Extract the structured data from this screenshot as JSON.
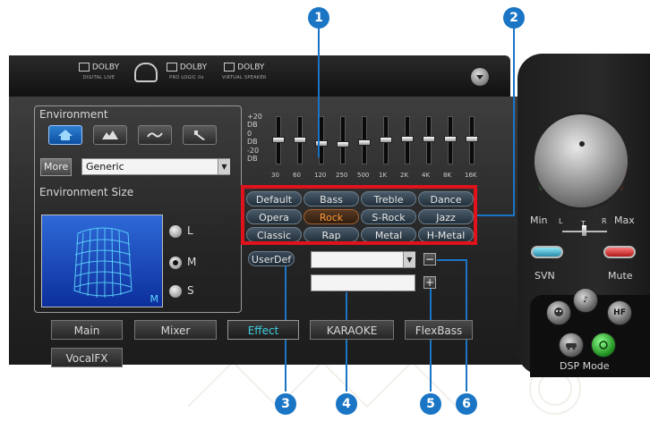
{
  "callouts": [
    "1",
    "2",
    "3",
    "4",
    "5",
    "6"
  ],
  "header": {
    "logos": [
      {
        "main": "DOLBY",
        "sub": "DIGITAL LIVE"
      },
      {
        "main": "DOLBY",
        "sub": "PRO LOGIC IIx"
      },
      {
        "main": "DOLBY",
        "sub": "VIRTUAL SPEAKER"
      }
    ]
  },
  "environment": {
    "label": "Environment",
    "buttons": [
      "home-icon",
      "mountain-icon",
      "wave-icon",
      "tool-icon"
    ],
    "more_label": "More",
    "selected": "Generic"
  },
  "environment_size": {
    "label": "Environment Size",
    "options": [
      "L",
      "M",
      "S"
    ],
    "selected": "M",
    "preview_letter": "M"
  },
  "eq": {
    "scale": [
      "+20",
      "DB",
      "0",
      "DB",
      "-20",
      "DB"
    ],
    "frequencies": [
      "30",
      "60",
      "120",
      "250",
      "500",
      "1K",
      "2K",
      "4K",
      "8K",
      "16K"
    ],
    "levels_db": [
      0,
      0,
      -3,
      -4,
      -2,
      0,
      1,
      1,
      1,
      1
    ]
  },
  "presets": {
    "items": [
      "Default",
      "Bass",
      "Treble",
      "Dance",
      "Opera",
      "Rock",
      "S-Rock",
      "Jazz",
      "Classic",
      "Rap",
      "Metal",
      "H-Metal"
    ],
    "selected": "Rock",
    "highlight_color": "#e0121c"
  },
  "userdef": {
    "label": "UserDef",
    "dropdown_value": "",
    "name_value": "",
    "add_label": "+",
    "remove_label": "−"
  },
  "tabs": [
    {
      "label": "Main"
    },
    {
      "label": "Mixer"
    },
    {
      "label": "Effect",
      "active": true
    },
    {
      "label": "KARAOKE"
    },
    {
      "label": "FlexBass"
    },
    {
      "label": "VocalFX"
    }
  ],
  "volume": {
    "min_label": "Min",
    "max_label": "Max",
    "l_label": "L",
    "r_label": "R",
    "t_label": "T"
  },
  "buttons": {
    "svn_label": "SVN",
    "mute_label": "Mute",
    "dsp_mode_label": "DSP Mode",
    "hf_label": "HF"
  },
  "colors": {
    "accent": "#1a76c4",
    "active_tab": "#3fd0e0",
    "selected_preset": "#ff9a3a"
  }
}
